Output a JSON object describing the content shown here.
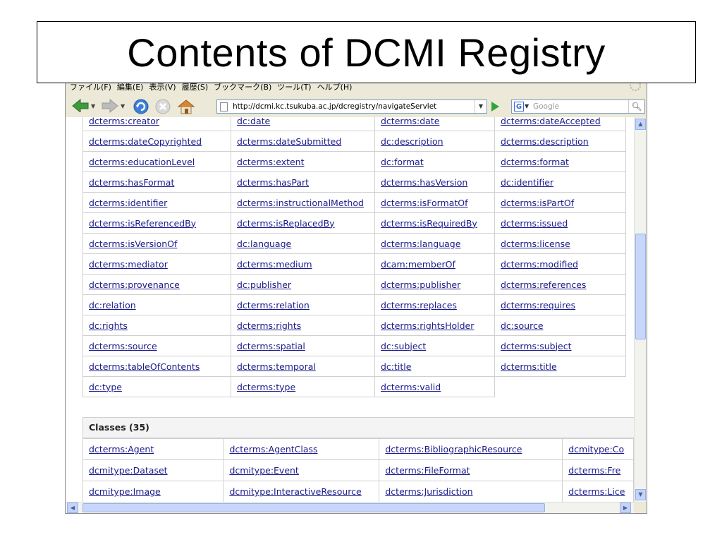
{
  "slide": {
    "title": "Contents of DCMI Registry"
  },
  "browser": {
    "menu": [
      "ファイル(F)",
      "編集(E)",
      "表示(V)",
      "履歴(S)",
      "ブックマーク(B)",
      "ツール(T)",
      "ヘルプ(H)"
    ],
    "url": "http://dcmi.kc.tsukuba.ac.jp/dcregistry/navigateServlet",
    "search_placeholder": "Google",
    "search_engine_letter": "G"
  },
  "properties": {
    "rows": [
      [
        "dcterms:creator",
        "dc:date",
        "dcterms:date",
        "dcterms:dateAccepted"
      ],
      [
        "dcterms:dateCopyrighted",
        "dcterms:dateSubmitted",
        "dc:description",
        "dcterms:description"
      ],
      [
        "dcterms:educationLevel",
        "dcterms:extent",
        "dc:format",
        "dcterms:format"
      ],
      [
        "dcterms:hasFormat",
        "dcterms:hasPart",
        "dcterms:hasVersion",
        "dc:identifier"
      ],
      [
        "dcterms:identifier",
        "dcterms:instructionalMethod",
        "dcterms:isFormatOf",
        "dcterms:isPartOf"
      ],
      [
        "dcterms:isReferencedBy",
        "dcterms:isReplacedBy",
        "dcterms:isRequiredBy",
        "dcterms:issued"
      ],
      [
        "dcterms:isVersionOf",
        "dc:language",
        "dcterms:language",
        "dcterms:license"
      ],
      [
        "dcterms:mediator",
        "dcterms:medium",
        "dcam:memberOf",
        "dcterms:modified"
      ],
      [
        "dcterms:provenance",
        "dc:publisher",
        "dcterms:publisher",
        "dcterms:references"
      ],
      [
        "dc:relation",
        "dcterms:relation",
        "dcterms:replaces",
        "dcterms:requires"
      ],
      [
        "dc:rights",
        "dcterms:rights",
        "dcterms:rightsHolder",
        "dc:source"
      ],
      [
        "dcterms:source",
        "dcterms:spatial",
        "dc:subject",
        "dcterms:subject"
      ],
      [
        "dcterms:tableOfContents",
        "dcterms:temporal",
        "dc:title",
        "dcterms:title"
      ],
      [
        "dc:type",
        "dcterms:type",
        "dcterms:valid",
        ""
      ]
    ]
  },
  "classes": {
    "heading": "Classes (35)",
    "rows": [
      [
        "dcterms:Agent",
        "dcterms:AgentClass",
        "dcterms:BibliographicResource",
        "dcmitype:Co"
      ],
      [
        "dcmitype:Dataset",
        "dcmitype:Event",
        "dcterms:FileFormat",
        "dcterms:Fre"
      ],
      [
        "dcmitype:Image",
        "dcmitype:InteractiveResource",
        "dcterms:Jurisdiction",
        "dcterms:Lice"
      ]
    ]
  },
  "colors": {
    "link": "#1a1a8a",
    "border": "#d0d0d0",
    "chrome": "#ece9d8"
  }
}
